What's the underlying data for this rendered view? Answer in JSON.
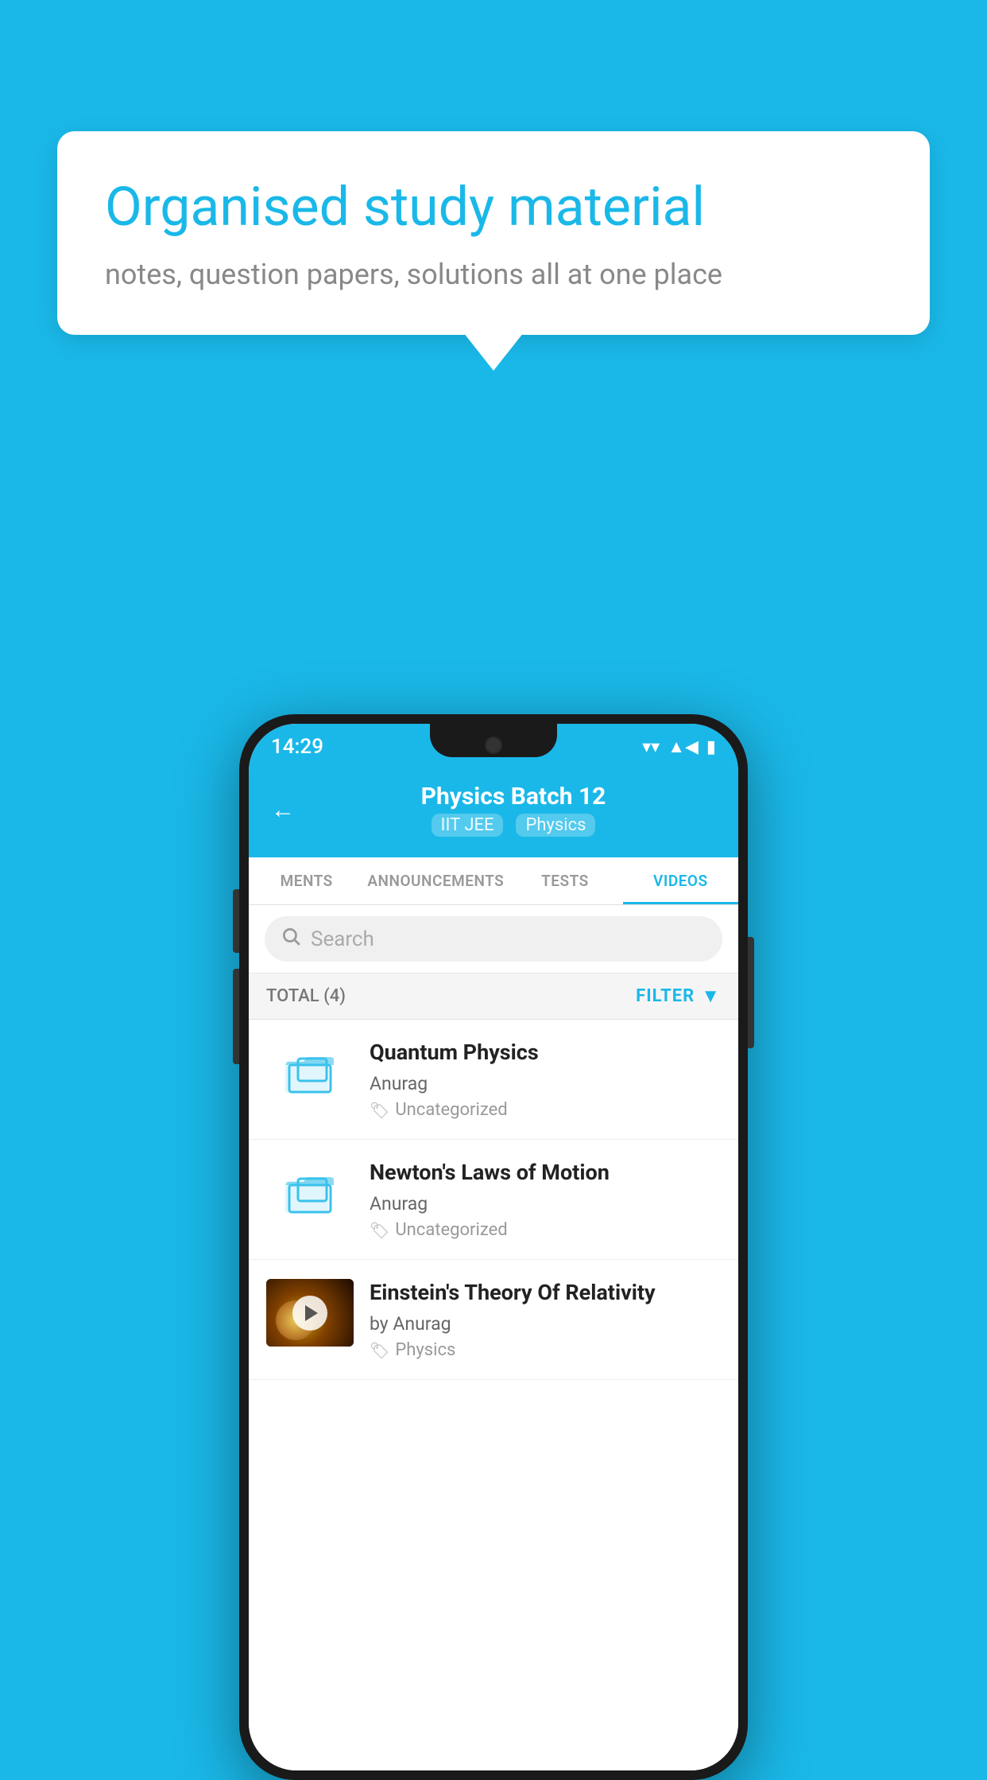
{
  "background": {
    "color": "#1ab8e8"
  },
  "speech_bubble": {
    "title": "Organised study material",
    "subtitle": "notes, question papers, solutions all at one place"
  },
  "phone": {
    "status_bar": {
      "time": "14:29",
      "wifi": "▼",
      "signal": "▲",
      "battery": "▮"
    },
    "header": {
      "back_label": "←",
      "title": "Physics Batch 12",
      "tag1": "IIT JEE",
      "tag2": "Physics"
    },
    "tabs": [
      {
        "label": "MENTS",
        "active": false
      },
      {
        "label": "ANNOUNCEMENTS",
        "active": false
      },
      {
        "label": "TESTS",
        "active": false
      },
      {
        "label": "VIDEOS",
        "active": true
      }
    ],
    "search": {
      "placeholder": "Search"
    },
    "filter_bar": {
      "total_label": "TOTAL (4)",
      "filter_label": "FILTER"
    },
    "videos": [
      {
        "id": 1,
        "title": "Quantum Physics",
        "author": "Anurag",
        "tag": "Uncategorized",
        "has_thumbnail": false
      },
      {
        "id": 2,
        "title": "Newton's Laws of Motion",
        "author": "Anurag",
        "tag": "Uncategorized",
        "has_thumbnail": false
      },
      {
        "id": 3,
        "title": "Einstein's Theory Of Relativity",
        "author": "by Anurag",
        "tag": "Physics",
        "has_thumbnail": true
      }
    ]
  }
}
